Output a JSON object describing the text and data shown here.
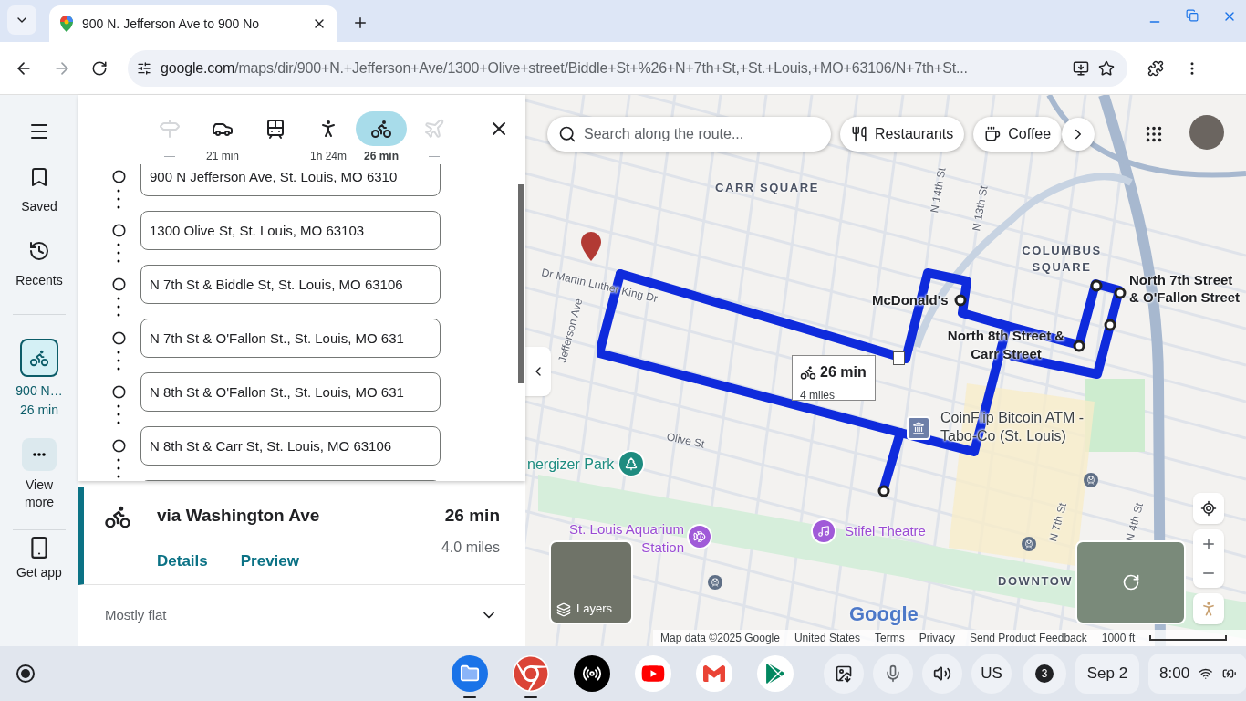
{
  "browser": {
    "tab_title": "900 N. Jefferson Ave to 900 No",
    "url_host": "google.com",
    "url_path": "/maps/dir/900+N.+Jefferson+Ave/1300+Olive+street/Biddle+St+%26+N+7th+St,+St.+Louis,+MO+63106/N+7th+St..."
  },
  "rail": {
    "items": [
      {
        "kind": "menu"
      },
      {
        "kind": "saved",
        "label": "Saved"
      },
      {
        "kind": "recents",
        "label": "Recents"
      }
    ],
    "trip": {
      "title": "900 N…",
      "time": "26 min"
    },
    "more": {
      "label": "View more"
    },
    "app": {
      "label": "Get app"
    }
  },
  "modes": [
    {
      "kind": "directions",
      "label": "—",
      "selected": false,
      "disabled": true
    },
    {
      "kind": "car",
      "label": "21 min",
      "selected": false,
      "disabled": false
    },
    {
      "kind": "transit",
      "selected": false,
      "disabled": false
    },
    {
      "kind": "walk",
      "label": "1h 24m",
      "selected": false,
      "disabled": false
    },
    {
      "kind": "bike",
      "label": "26 min",
      "selected": true,
      "disabled": false
    },
    {
      "kind": "plane",
      "label": "—",
      "selected": false,
      "disabled": true
    }
  ],
  "stops": [
    "900 N Jefferson Ave, St. Louis, MO 6310",
    "1300 Olive St, St. Louis, MO 63103",
    "N 7th St & Biddle St, St. Louis, MO 63106",
    "N 7th St & O'Fallon St., St. Louis, MO 631",
    "N 8th St & O'Fallon St., St. Louis, MO 631",
    "N 8th St & Carr St, St. Louis, MO 63106"
  ],
  "route": {
    "title": "via Washington Ave",
    "time": "26 min",
    "distance": "4.0 miles",
    "links": [
      "Details",
      "Preview"
    ]
  },
  "terrain": "Mostly flat",
  "map": {
    "search_placeholder": "Search along the route...",
    "chips": [
      {
        "kind": "restaurants",
        "label": "Restaurants"
      },
      {
        "kind": "coffee",
        "label": "Coffee"
      }
    ],
    "labels": [
      {
        "kind": "area",
        "text": "CARR SQUARE"
      },
      {
        "kind": "area",
        "text": "COLUMBUS SQUARE"
      },
      {
        "kind": "street",
        "text": "Dr Martin Luther King Dr"
      },
      {
        "kind": "street",
        "text": "Jefferson Ave"
      },
      {
        "kind": "street",
        "text": "N 14th St"
      },
      {
        "kind": "street",
        "text": "N 13th St"
      },
      {
        "kind": "street",
        "text": "Olive St"
      },
      {
        "kind": "street",
        "text": "N 7th St"
      },
      {
        "kind": "street",
        "text": "N 4th St"
      },
      {
        "kind": "area",
        "text": "DOWNTOW"
      },
      {
        "kind": "place",
        "text": "McDonald's"
      },
      {
        "kind": "place",
        "text": "North 7th Street & O'Fallon Street"
      },
      {
        "kind": "place",
        "text": "North 8th Street & Carr Street"
      },
      {
        "kind": "business",
        "text": "CoinFlip Bitcoin ATM - Tabo-Co (St. Louis)"
      },
      {
        "kind": "park",
        "text": "nergizer Park"
      },
      {
        "kind": "venue",
        "text": "St. Louis Aquarium Station"
      },
      {
        "kind": "venue",
        "text": "Stifel Theatre"
      }
    ],
    "callout": {
      "time": "26 min",
      "distance": "4 miles"
    },
    "layers_label": "Layers",
    "logo": "Google",
    "footer": [
      "Map data ©2025 Google",
      "United States",
      "Terms",
      "Privacy",
      "Send Product Feedback"
    ],
    "scale": "1000 ft"
  },
  "shelf": {
    "apps": [
      {
        "kind": "files",
        "open": true
      },
      {
        "kind": "chrome",
        "open": true
      },
      {
        "kind": "podcast",
        "open": false
      },
      {
        "kind": "youtube",
        "open": false
      },
      {
        "kind": "gmail",
        "open": false
      },
      {
        "kind": "play",
        "open": false
      }
    ],
    "keyboard": "US",
    "notifications": "3",
    "date": "Sep 2",
    "time": "8:00"
  }
}
